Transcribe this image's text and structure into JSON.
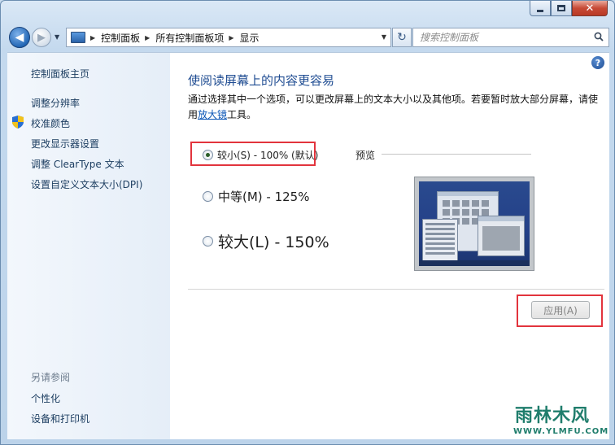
{
  "window": {
    "minimize": "minimize",
    "maximize": "maximize",
    "close": "close"
  },
  "nav": {
    "back_glyph": "◀",
    "forward_glyph": "▶",
    "breadcrumbs": [
      "控制面板",
      "所有控制面板项",
      "显示"
    ],
    "refresh_glyph": "↻",
    "search_placeholder": "搜索控制面板"
  },
  "sidebar": {
    "home": "控制面板主页",
    "links": [
      "调整分辨率",
      "校准颜色",
      "更改显示器设置",
      "调整 ClearType 文本",
      "设置自定义文本大小(DPI)"
    ],
    "see_also_heading": "另请参阅",
    "see_also_links": [
      "个性化",
      "设备和打印机"
    ]
  },
  "main": {
    "help_glyph": "?",
    "heading": "使阅读屏幕上的内容更容易",
    "description_pre": "通过选择其中一个选项，可以更改屏幕上的文本大小以及其他项。若要暂时放大部分屏幕，请使用",
    "magnifier_link": "放大镜",
    "description_post": "工具。",
    "options": [
      {
        "label": "较小(S) - 100% (默认)",
        "checked": true
      },
      {
        "label": "中等(M) - 125%",
        "checked": false
      },
      {
        "label": "较大(L) - 150%",
        "checked": false
      }
    ],
    "preview_label": "预览",
    "apply_button": "应用(A)"
  },
  "watermark": {
    "text": "雨林木风",
    "url": "WWW.YLMFU.COM"
  },
  "colors": {
    "heading": "#1f4c92",
    "link": "#0a55b6",
    "highlight": "#e2343d"
  }
}
